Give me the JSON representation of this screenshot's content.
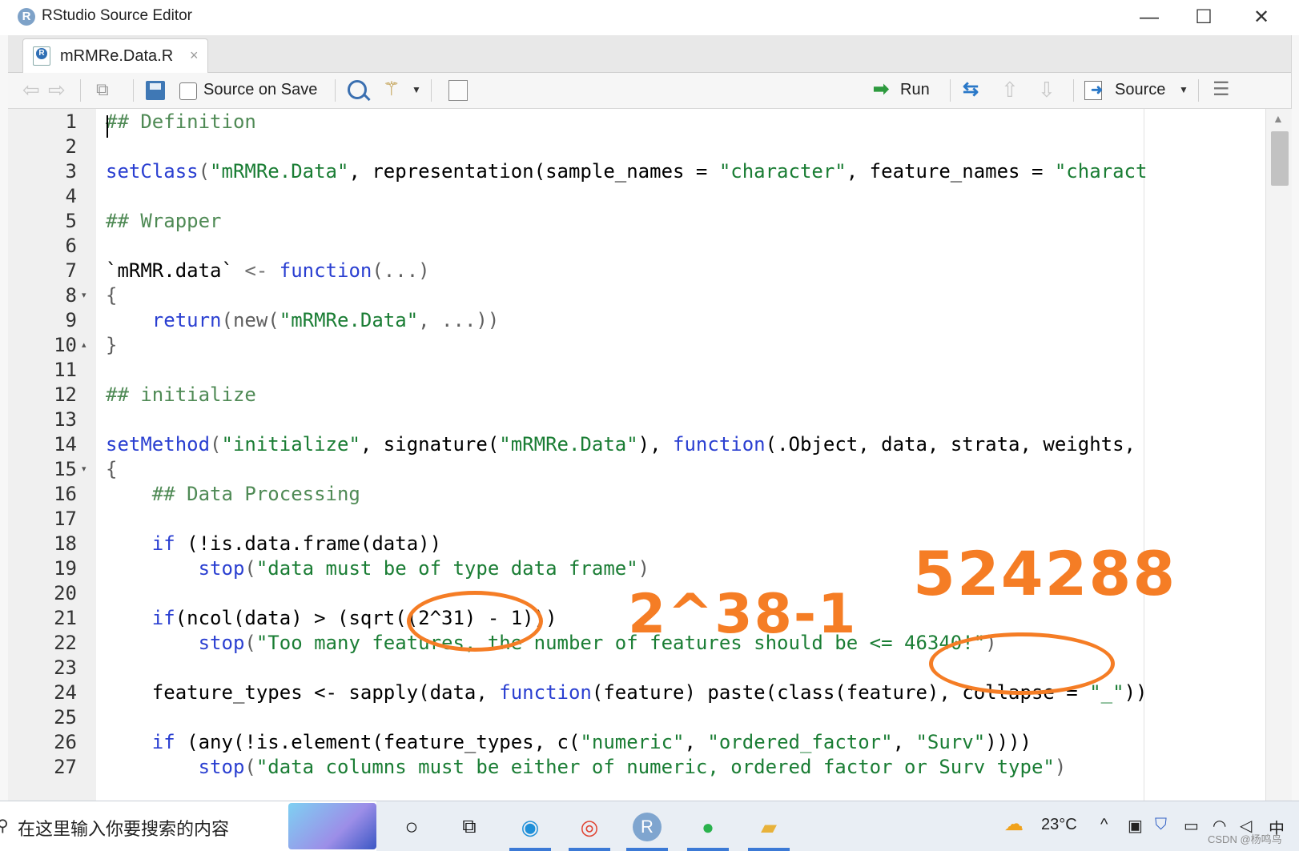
{
  "window": {
    "title": "RStudio Source Editor",
    "controls": {
      "minimize": "—",
      "maximize": "☐",
      "close": "✕"
    }
  },
  "tab": {
    "filename": "mRMRe.Data.R",
    "close": "×"
  },
  "toolbar": {
    "source_on_save": "Source on Save",
    "run": "Run",
    "source": "Source",
    "source_on_save_checked": false
  },
  "editor": {
    "lines": [
      {
        "n": "1",
        "fold": ""
      },
      {
        "n": "2",
        "fold": ""
      },
      {
        "n": "3",
        "fold": ""
      },
      {
        "n": "4",
        "fold": ""
      },
      {
        "n": "5",
        "fold": ""
      },
      {
        "n": "6",
        "fold": ""
      },
      {
        "n": "7",
        "fold": ""
      },
      {
        "n": "8",
        "fold": "▾"
      },
      {
        "n": "9",
        "fold": ""
      },
      {
        "n": "10",
        "fold": "▴"
      },
      {
        "n": "11",
        "fold": ""
      },
      {
        "n": "12",
        "fold": ""
      },
      {
        "n": "13",
        "fold": ""
      },
      {
        "n": "14",
        "fold": ""
      },
      {
        "n": "15",
        "fold": "▾"
      },
      {
        "n": "16",
        "fold": ""
      },
      {
        "n": "17",
        "fold": ""
      },
      {
        "n": "18",
        "fold": ""
      },
      {
        "n": "19",
        "fold": ""
      },
      {
        "n": "20",
        "fold": ""
      },
      {
        "n": "21",
        "fold": ""
      },
      {
        "n": "22",
        "fold": ""
      },
      {
        "n": "23",
        "fold": ""
      },
      {
        "n": "24",
        "fold": ""
      },
      {
        "n": "25",
        "fold": ""
      },
      {
        "n": "26",
        "fold": ""
      },
      {
        "n": "27",
        "fold": ""
      }
    ],
    "code": {
      "l1_comment": "## Definition",
      "l3_fn": "setClass",
      "l3_a": "(",
      "l3_s1": "\"mRMRe.Data\"",
      "l3_b": ", representation(sample_names = ",
      "l3_s2": "\"character\"",
      "l3_c": ", feature_names = ",
      "l3_s3": "\"charact",
      "l5_comment": "## Wrapper",
      "l7_a": "`mRMR.data`",
      "l7_op": " <- ",
      "l7_kw": "function",
      "l7_b": "(...)",
      "l8_brace": "{",
      "l9_indent": "    ",
      "l9_kw": "return",
      "l9_a": "(new(",
      "l9_s": "\"mRMRe.Data\"",
      "l9_b": ", ...))",
      "l10_brace": "}",
      "l12_comment": "## initialize",
      "l14_fn": "setMethod",
      "l14_a": "(",
      "l14_s1": "\"initialize\"",
      "l14_b": ", signature(",
      "l14_s2": "\"mRMRe.Data\"",
      "l14_c": "), ",
      "l14_kw": "function",
      "l14_d": "(.Object, data, strata, weights,",
      "l15_brace": "{",
      "l16_indent": "    ",
      "l16_comment": "## Data Processing",
      "l18_indent": "    ",
      "l18_kw": "if",
      "l18_a": " (!is.data.frame(data))",
      "l19_indent": "        ",
      "l19_fn": "stop",
      "l19_a": "(",
      "l19_s": "\"data must be of type data frame\"",
      "l19_b": ")",
      "l21_indent": "    ",
      "l21_kw": "if",
      "l21_a": "(ncol(data) > (sqrt((2^31) - 1)))",
      "l22_indent": "        ",
      "l22_fn": "stop",
      "l22_a": "(",
      "l22_s": "\"Too many features, the number of features should be <= 46340!\"",
      "l22_b": ")",
      "l24_indent": "    ",
      "l24_a": "feature_types <- sapply(data, ",
      "l24_kw": "function",
      "l24_b": "(feature) paste(class(feature), collapse = ",
      "l24_s": "\"_\"",
      "l24_c": "))",
      "l26_indent": "    ",
      "l26_kw": "if",
      "l26_a": " (any(!is.element(feature_types, c(",
      "l26_s1": "\"numeric\"",
      "l26_b": ", ",
      "l26_s2": "\"ordered_factor\"",
      "l26_c": ", ",
      "l26_s3": "\"Surv\"",
      "l26_d": "))))",
      "l27_indent": "        ",
      "l27_fn": "stop",
      "l27_a": "(",
      "l27_s": "\"data columns must be either of numeric, ordered factor or Surv type\"",
      "l27_b": ")"
    }
  },
  "annotations": {
    "exponent_note": "2^38-1",
    "max_value_note": "524288",
    "color": "#f57d25"
  },
  "taskbar": {
    "search_placeholder": "在这里输入你要搜索的内容",
    "weather": "23°C",
    "ime": "中",
    "watermark": "CSDN @杨鸣鸟"
  }
}
